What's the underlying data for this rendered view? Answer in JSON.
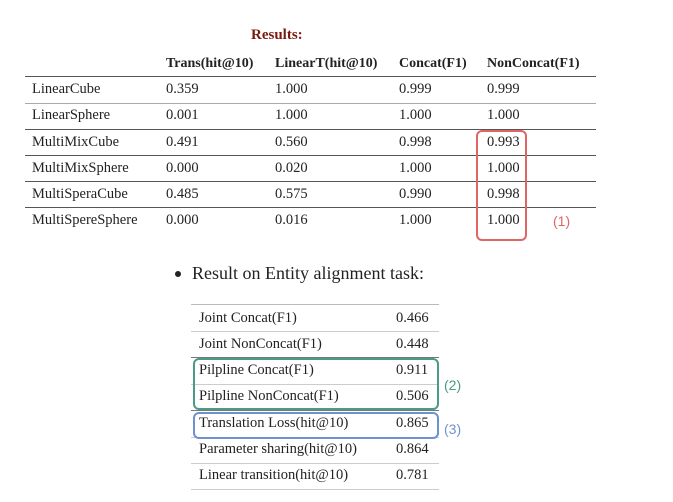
{
  "results_table": {
    "title": "Results:",
    "headers": [
      "Trans(hit@10)",
      "LinearT(hit@10)",
      "Concat(F1)",
      "NonConcat(F1)"
    ],
    "rows": [
      {
        "name": "LinearCube",
        "values": [
          "0.359",
          "1.000",
          "0.999",
          "0.999"
        ]
      },
      {
        "name": "LinearSphere",
        "values": [
          "0.001",
          "1.000",
          "1.000",
          "1.000"
        ]
      },
      {
        "name": "MultiMixCube",
        "values": [
          "0.491",
          "0.560",
          "0.998",
          "0.993"
        ]
      },
      {
        "name": "MultiMixSphere",
        "values": [
          "0.000",
          "0.020",
          "1.000",
          "1.000"
        ]
      },
      {
        "name": "MultiSperaCube",
        "values": [
          "0.485",
          "0.575",
          "0.990",
          "0.998"
        ]
      },
      {
        "name": "MultiSpereSphere",
        "values": [
          "0.000",
          "0.016",
          "1.000",
          "1.000"
        ]
      }
    ],
    "annotation": {
      "label": "(1)",
      "color": "#e06666"
    }
  },
  "alignment": {
    "bullet_text": "Result on Entity alignment task:",
    "rows": [
      {
        "name": "Joint Concat(F1)",
        "value": "0.466"
      },
      {
        "name": "Joint NonConcat(F1)",
        "value": "0.448"
      },
      {
        "name": "Pilpline Concat(F1)",
        "value": "0.911"
      },
      {
        "name": "Pilpline NonConcat(F1)",
        "value": "0.506"
      },
      {
        "name": "Translation Loss(hit@10)",
        "value": "0.865"
      },
      {
        "name": "Parameter sharing(hit@10)",
        "value": "0.864"
      },
      {
        "name": "Linear transition(hit@10)",
        "value": "0.781"
      }
    ],
    "annotations": [
      {
        "label": "(2)",
        "color": "#4a9a86"
      },
      {
        "label": "(3)",
        "color": "#6d93cf"
      }
    ]
  }
}
